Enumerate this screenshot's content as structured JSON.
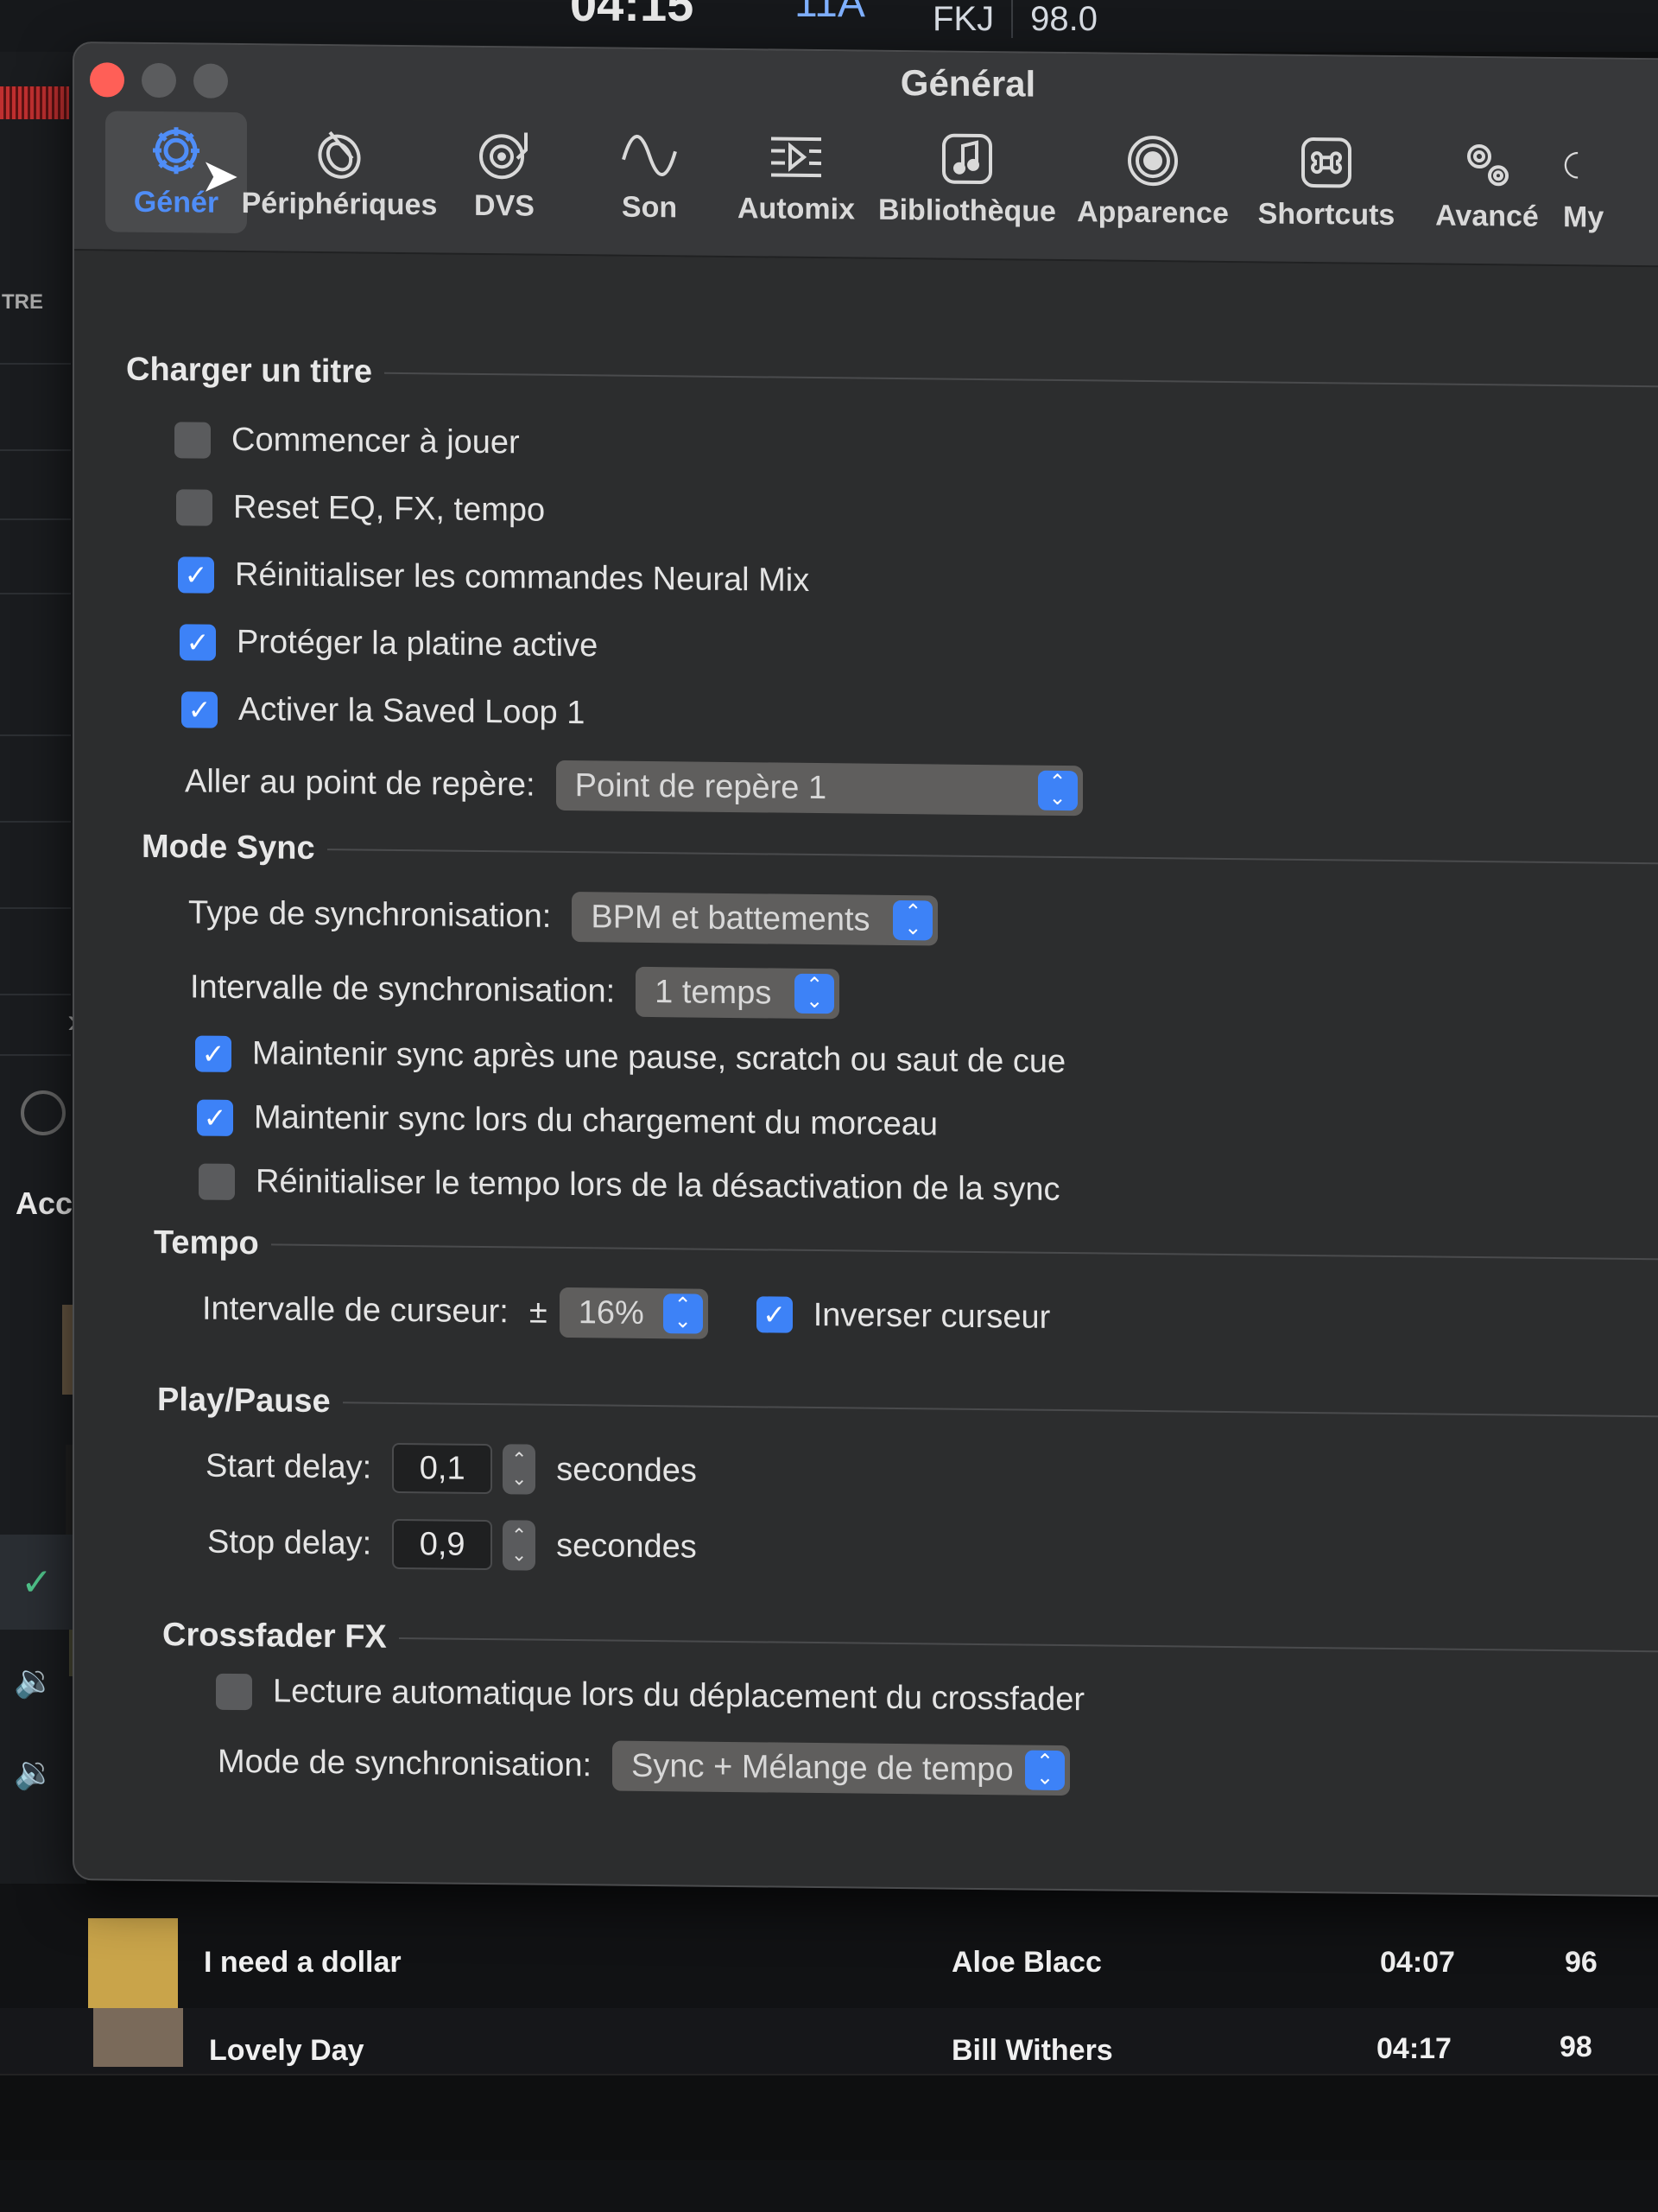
{
  "background_app": {
    "top_artist": "FKJ",
    "top_bpm": "98.0",
    "top_clock": "04:15",
    "top_key": "11A",
    "left_label": "TRE",
    "left_tab": "Accu",
    "tracks": [
      {
        "title": "I need a dollar",
        "artist": "Aloe Blacc",
        "duration": "04:07",
        "bpm": "96"
      },
      {
        "title": "Lovely Day",
        "artist": "Bill Withers",
        "duration": "04:17",
        "bpm": "98"
      }
    ]
  },
  "window": {
    "title": "Général",
    "toolbar": [
      {
        "label": "Général",
        "icon": "gear-icon"
      },
      {
        "label": "Périphériques",
        "icon": "device-icon"
      },
      {
        "label": "DVS",
        "icon": "turntable-icon"
      },
      {
        "label": "Son",
        "icon": "waveform-icon"
      },
      {
        "label": "Automix",
        "icon": "automix-icon"
      },
      {
        "label": "Bibliothèque",
        "icon": "music-note-icon"
      },
      {
        "label": "Apparence",
        "icon": "eye-icon"
      },
      {
        "label": "Shortcuts",
        "icon": "command-icon"
      },
      {
        "label": "Avancé",
        "icon": "gears-icon"
      },
      {
        "label": "My",
        "icon": "partial-icon"
      }
    ],
    "toolbar_active_label": "Génér"
  },
  "load_track": {
    "title": "Charger un titre",
    "options": [
      {
        "label": "Commencer à jouer",
        "checked": false
      },
      {
        "label": "Reset EQ, FX, tempo",
        "checked": false
      },
      {
        "label": "Réinitialiser les commandes Neural Mix",
        "checked": true
      },
      {
        "label": "Protéger la platine active",
        "checked": true
      },
      {
        "label": "Activer la Saved Loop 1",
        "checked": true
      }
    ],
    "cue_label": "Aller au point de repère:",
    "cue_value": "Point de repère 1"
  },
  "sync_mode": {
    "title": "Mode Sync",
    "type_label": "Type de synchronisation:",
    "type_value": "BPM et battements",
    "interval_label": "Intervalle de synchronisation:",
    "interval_value": "1 temps",
    "options": [
      {
        "label": "Maintenir sync après une pause, scratch ou saut de cue",
        "checked": true
      },
      {
        "label": "Maintenir sync lors du chargement du morceau",
        "checked": true
      },
      {
        "label": "Réinitialiser le tempo lors de la désactivation de la sync",
        "checked": false
      }
    ]
  },
  "tempo": {
    "title": "Tempo",
    "range_label": "Intervalle de curseur:",
    "range_prefix": "±",
    "range_value": "16%",
    "invert_label": "Inverser curseur",
    "invert_checked": true
  },
  "play_pause": {
    "title": "Play/Pause",
    "start_label": "Start delay:",
    "start_value": "0,1",
    "stop_label": "Stop delay:",
    "stop_value": "0,9",
    "unit": "secondes"
  },
  "crossfader_fx": {
    "title": "Crossfader FX",
    "autoplay_label": "Lecture automatique lors du déplacement du crossfader",
    "autoplay_checked": false,
    "mode_label": "Mode de synchronisation:",
    "mode_value": "Sync + Mélange de tempo"
  },
  "colors": {
    "accent": "#3d82f7",
    "window_bg": "#2c2d2e",
    "titlebar_bg": "#37383a",
    "close_red": "#ff5f57"
  }
}
